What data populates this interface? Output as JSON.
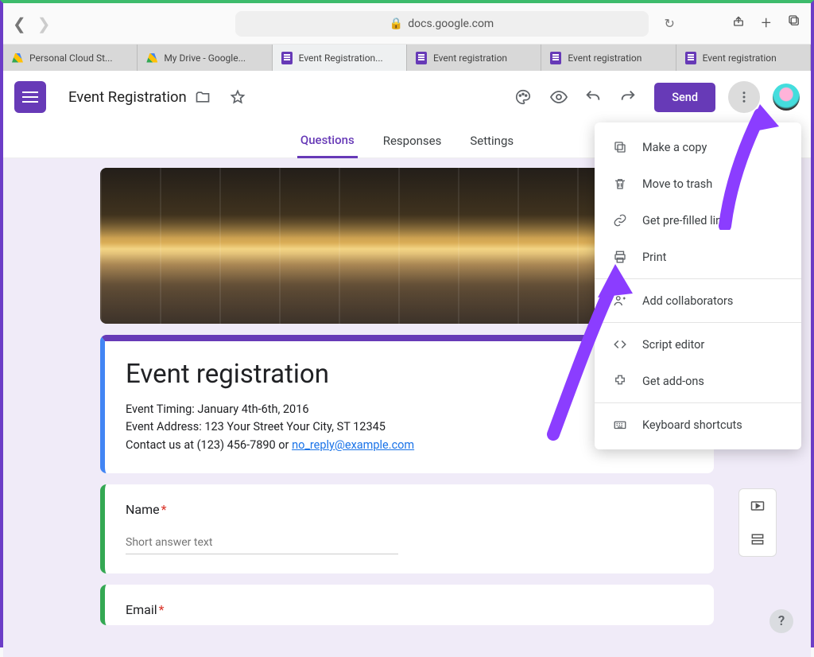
{
  "browser": {
    "url": "docs.google.com",
    "tabs": [
      {
        "label": "Personal Cloud St...",
        "kind": "drive"
      },
      {
        "label": "My Drive - Google...",
        "kind": "drive"
      },
      {
        "label": "Event Registration...",
        "kind": "forms",
        "active": true
      },
      {
        "label": "Event registration",
        "kind": "forms"
      },
      {
        "label": "Event registration",
        "kind": "forms"
      },
      {
        "label": "Event registration",
        "kind": "forms"
      }
    ]
  },
  "header": {
    "doc_title": "Event Registration",
    "send_label": "Send"
  },
  "form_tabs": {
    "questions": "Questions",
    "responses": "Responses",
    "settings": "Settings"
  },
  "form": {
    "title": "Event registration",
    "desc_line1": "Event Timing: January 4th-6th, 2016",
    "desc_line2": "Event Address: 123 Your Street Your City, ST 12345",
    "desc_line3_pre": "Contact us at (123) 456-7890 or ",
    "desc_email": "no_reply@example.com",
    "q1_label": "Name",
    "q1_placeholder": "Short answer text",
    "q2_label": "Email"
  },
  "menu": {
    "copy": "Make a copy",
    "trash": "Move to trash",
    "prefilled": "Get pre-filled link",
    "print": "Print",
    "collab": "Add collaborators",
    "script": "Script editor",
    "addons": "Get add-ons",
    "shortcuts": "Keyboard shortcuts"
  },
  "colors": {
    "accent": "#673ab7",
    "arrow": "#8b3dff"
  }
}
